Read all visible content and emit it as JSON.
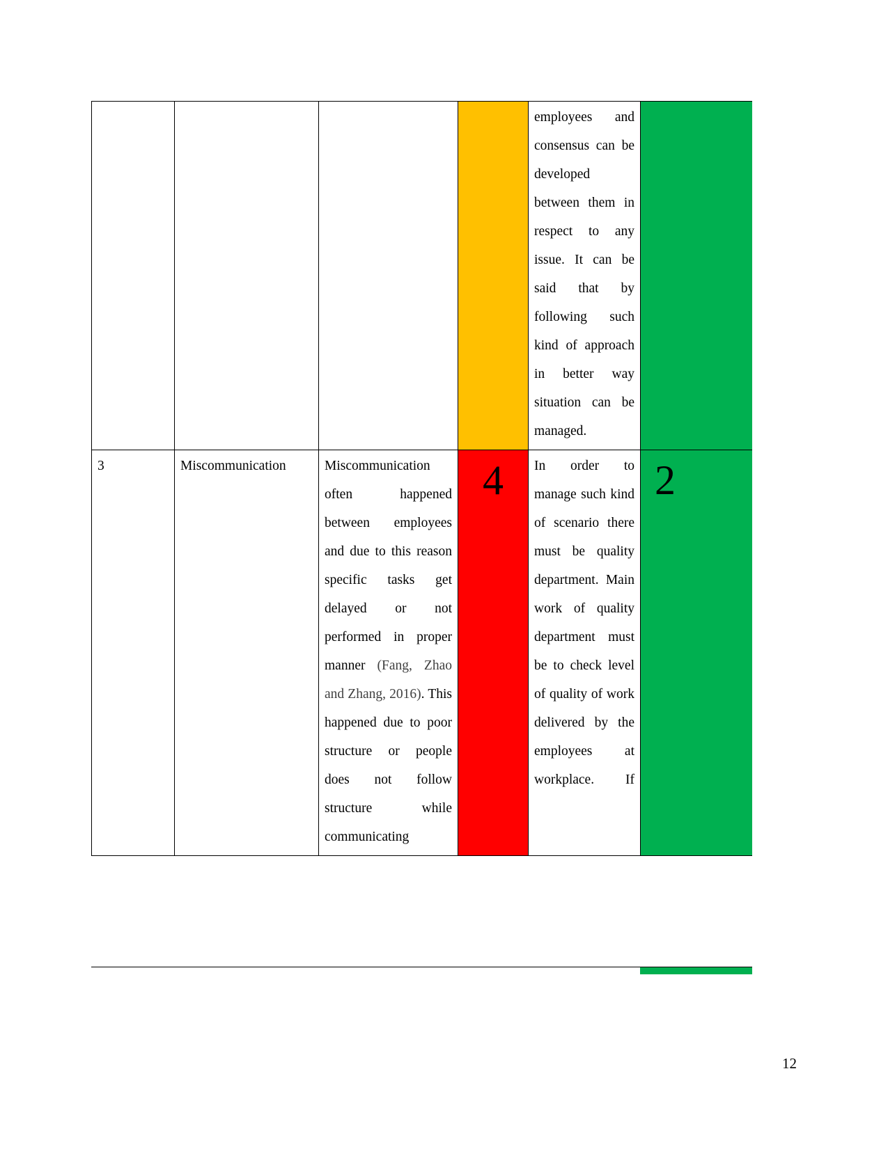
{
  "document": {
    "page_number": "12",
    "citation_color": "#3f3f3f"
  },
  "colors": {
    "orange": "#FFC000",
    "red": "#FF0000",
    "green": "#00B050",
    "border": "#000000",
    "text": "#000000"
  },
  "table": {
    "rows": [
      {
        "no": "",
        "risk": "",
        "description": "",
        "score": "",
        "score_fill": "orange",
        "mitigation": "employees and consensus can be developed between them in respect to any issue. It can be said that by following such kind of approach in better way situation can be managed.",
        "rating": "",
        "rating_fill": "green"
      },
      {
        "no": "3",
        "risk": "Miscommunication",
        "description_part1": "Miscommunication often happened between employees and due to this reason specific tasks get delayed or not performed in proper manner ",
        "description_citation": "(Fang, Zhao and Zhang, 2016)",
        "description_part2": ". This happened due to poor structure or people does not follow structure while communicating",
        "score": "4",
        "score_fill": "red",
        "mitigation": "In order to manage such kind of scenario there must be quality department. Main work of quality department must be to check level of quality of work delivered by the employees at workplace. If",
        "rating": "2",
        "rating_fill": "green"
      }
    ]
  }
}
